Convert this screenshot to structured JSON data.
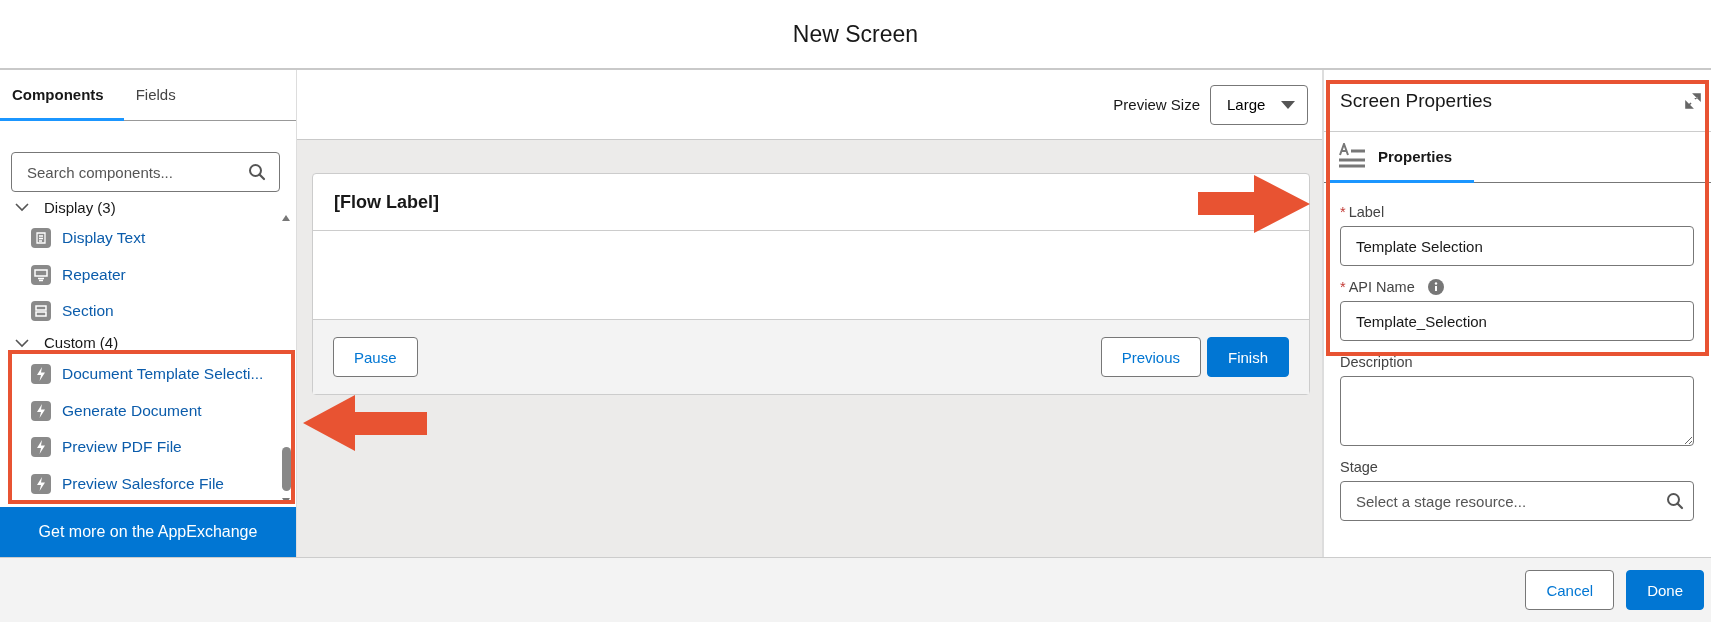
{
  "modal": {
    "title": "New Screen"
  },
  "left_panel": {
    "tabs": [
      {
        "label": "Components",
        "selected": true
      },
      {
        "label": "Fields",
        "selected": false
      }
    ],
    "search": {
      "placeholder": "Search components..."
    },
    "groups": [
      {
        "label": "Display (3)",
        "expanded": true,
        "children": [
          {
            "label": "Display Text",
            "kind": "text"
          },
          {
            "label": "Repeater",
            "kind": "repeater"
          },
          {
            "label": "Section",
            "kind": "section"
          }
        ]
      },
      {
        "label": "Custom (4)",
        "expanded": true,
        "children": [
          {
            "label": "Document Template Selecti...",
            "kind": "custom"
          },
          {
            "label": "Generate Document",
            "kind": "custom"
          },
          {
            "label": "Preview PDF File",
            "kind": "custom"
          },
          {
            "label": "Preview Salesforce File",
            "kind": "custom"
          }
        ]
      }
    ],
    "appexchange_button": "Get more on the AppExchange"
  },
  "canvas": {
    "preview_size_label": "Preview Size",
    "preview_size_value": "Large",
    "flow_label": "[Flow Label]",
    "buttons_left": [
      "Pause"
    ],
    "buttons_right": [
      {
        "label": "Previous",
        "primary": false
      },
      {
        "label": "Finish",
        "primary": true
      }
    ]
  },
  "properties_panel": {
    "title": "Screen Properties",
    "tabs": [
      {
        "label": "Properties",
        "selected": true
      }
    ],
    "fields": [
      {
        "required_mark": "*",
        "label": "Label",
        "info": false,
        "kind": "input",
        "value": "Template Selection"
      },
      {
        "required_mark": "*",
        "label": "API Name",
        "info": true,
        "kind": "input",
        "value": "Template_Selection"
      },
      {
        "label": "Description",
        "info": false,
        "kind": "textarea"
      },
      {
        "label": "Stage",
        "info": false,
        "kind": "search",
        "placeholder": "Select a stage resource..."
      }
    ]
  },
  "footer": {
    "buttons": [
      {
        "label": "Cancel",
        "primary": false
      },
      {
        "label": "Done",
        "primary": true
      }
    ]
  }
}
